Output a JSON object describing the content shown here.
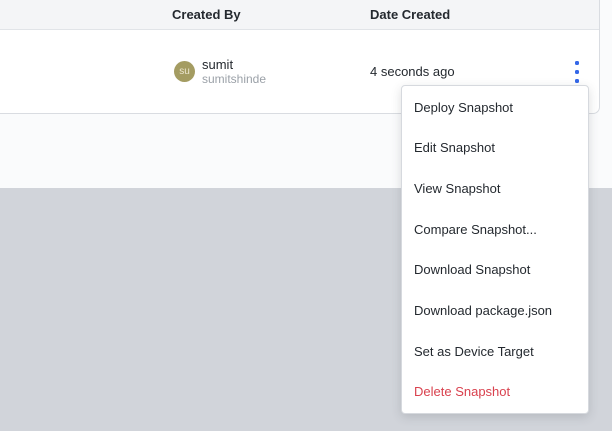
{
  "table": {
    "columns": {
      "created_by": "Created By",
      "date_created": "Date Created"
    },
    "row": {
      "avatar_initials": "su",
      "name": "sumit",
      "username": "sumitshinde",
      "date_created": "4 seconds ago"
    }
  },
  "menu": {
    "items": [
      {
        "label": "Deploy Snapshot"
      },
      {
        "label": "Edit Snapshot"
      },
      {
        "label": "View Snapshot"
      },
      {
        "label": "Compare Snapshot..."
      },
      {
        "label": "Download Snapshot"
      },
      {
        "label": "Download package.json"
      },
      {
        "label": "Set as Device Target"
      },
      {
        "label": "Delete Snapshot"
      }
    ]
  },
  "icons": {
    "row_actions": "kebab-vertical-icon"
  },
  "colors": {
    "accent_blue": "#3467e8",
    "danger_red": "#d9414e",
    "avatar_olive": "#a49c62",
    "band_gray": "#d1d4da"
  }
}
